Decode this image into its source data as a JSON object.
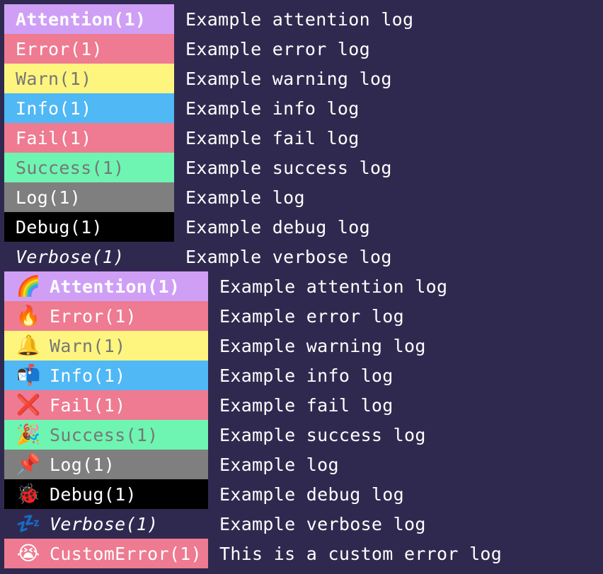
{
  "colors": {
    "background": "#30294f",
    "attention": "#cf9ff6",
    "error": "#ee7b91",
    "warn": "#fef57f",
    "info": "#4fb8f5",
    "fail": "#ee7b91",
    "success": "#6ef5b1",
    "log": "#7f7f7f",
    "debug": "#000000",
    "verbose": "transparent"
  },
  "plain_logs": [
    {
      "level": "attention",
      "label": "Attention(1)",
      "message": "Example attention log",
      "bg": "#cf9ff6",
      "fg": "#ffffff",
      "style": "bold"
    },
    {
      "level": "error",
      "label": "Error(1)",
      "message": "Example error log",
      "bg": "#ee7b91",
      "fg": "#ffffff",
      "style": ""
    },
    {
      "level": "warn",
      "label": "Warn(1)",
      "message": "Example warning log",
      "bg": "#fef57f",
      "fg": "#777777",
      "style": ""
    },
    {
      "level": "info",
      "label": "Info(1)",
      "message": "Example info log",
      "bg": "#4fb8f5",
      "fg": "#ffffff",
      "style": ""
    },
    {
      "level": "fail",
      "label": "Fail(1)",
      "message": "Example fail log",
      "bg": "#ee7b91",
      "fg": "#ffffff",
      "style": ""
    },
    {
      "level": "success",
      "label": "Success(1)",
      "message": "Example success log",
      "bg": "#6ef5b1",
      "fg": "#777777",
      "style": ""
    },
    {
      "level": "log",
      "label": "Log(1)",
      "message": "Example log",
      "bg": "#7f7f7f",
      "fg": "#ffffff",
      "style": ""
    },
    {
      "level": "debug",
      "label": "Debug(1)",
      "message": "Example debug log",
      "bg": "#000000",
      "fg": "#ffffff",
      "style": ""
    },
    {
      "level": "verbose",
      "label": "Verbose(1)",
      "message": "Example verbose log",
      "bg": "transparent",
      "fg": "#ffffff",
      "style": "italic"
    }
  ],
  "emoji_logs": [
    {
      "level": "attention",
      "icon": "🌈",
      "icon_name": "rainbow-icon",
      "label": "Attention(1)",
      "message": "Example attention log",
      "bg": "#cf9ff6",
      "fg": "#ffffff",
      "style": "bold"
    },
    {
      "level": "error",
      "icon": "🔥",
      "icon_name": "fire-icon",
      "label": "Error(1)",
      "message": "Example error log",
      "bg": "#ee7b91",
      "fg": "#ffffff",
      "style": ""
    },
    {
      "level": "warn",
      "icon": "🔔",
      "icon_name": "bell-icon",
      "label": "Warn(1)",
      "message": "Example warning log",
      "bg": "#fef57f",
      "fg": "#777777",
      "style": ""
    },
    {
      "level": "info",
      "icon": "📬",
      "icon_name": "mailbox-icon",
      "label": "Info(1)",
      "message": "Example info log",
      "bg": "#4fb8f5",
      "fg": "#ffffff",
      "style": ""
    },
    {
      "level": "fail",
      "icon": "❌",
      "icon_name": "cross-mark-icon",
      "label": "Fail(1)",
      "message": "Example fail log",
      "bg": "#ee7b91",
      "fg": "#ffffff",
      "style": ""
    },
    {
      "level": "success",
      "icon": "🎉",
      "icon_name": "party-popper-icon",
      "label": "Success(1)",
      "message": "Example success log",
      "bg": "#6ef5b1",
      "fg": "#777777",
      "style": ""
    },
    {
      "level": "log",
      "icon": "📌",
      "icon_name": "pushpin-icon",
      "label": "Log(1)",
      "message": "Example log",
      "bg": "#7f7f7f",
      "fg": "#ffffff",
      "style": ""
    },
    {
      "level": "debug",
      "icon": "🐞",
      "icon_name": "ladybug-icon",
      "label": "Debug(1)",
      "message": "Example debug log",
      "bg": "#000000",
      "fg": "#ffffff",
      "style": ""
    },
    {
      "level": "verbose",
      "icon": "💤",
      "icon_name": "zzz-icon",
      "label": "Verbose(1)",
      "message": "Example verbose log",
      "bg": "transparent",
      "fg": "#ffffff",
      "style": "italic"
    },
    {
      "level": "custom-error",
      "icon": "😭",
      "icon_name": "crying-face-icon",
      "label": "CustomError(1)",
      "message": "This is a custom error log",
      "bg": "#ee7b91",
      "fg": "#ffffff",
      "style": ""
    }
  ]
}
